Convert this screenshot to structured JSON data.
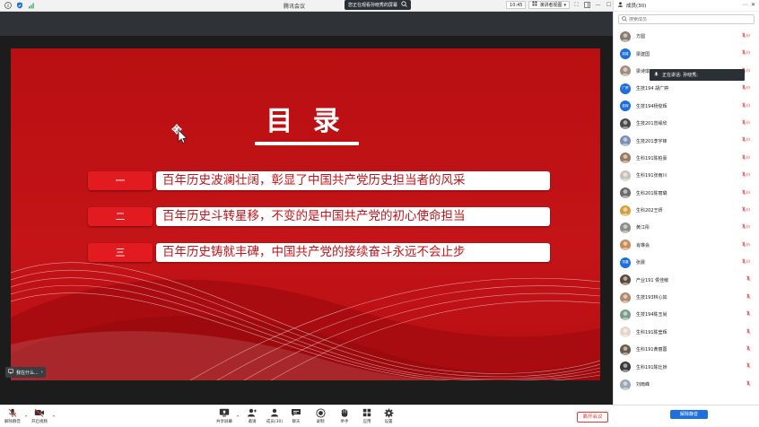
{
  "app": {
    "title": "腾讯会议",
    "share_banner": "您正在观看孙晓秀的屏幕",
    "time": "10:45",
    "view_mode": "演讲者视图"
  },
  "slide": {
    "title": "目 录",
    "items": [
      {
        "num": "一",
        "text": "百年历史波澜壮阔，彰显了中国共产党历史担当者的风采"
      },
      {
        "num": "二",
        "text": "百年历史斗转星移，不变的是中国共产党的初心使命担当"
      },
      {
        "num": "三",
        "text": "百年历史铸就丰碑，中国共产党的接续奋斗永远不会止步"
      }
    ],
    "speaker_label": "我在什么..."
  },
  "toolbar": {
    "mute_label": "解除静音",
    "video_label": "开启视频",
    "share_label": "共享屏幕",
    "invite_label": "邀请",
    "members_label": "成员(30)",
    "chat_label": "聊天",
    "record_label": "录制",
    "hand_label": "举手",
    "apps_label": "应用",
    "settings_label": "设置",
    "leave_label": "离开会议"
  },
  "panel": {
    "title": "成员(30)",
    "search_placeholder": "搜索成员",
    "speaking_tip": "正在讲话: 孙晓秀;",
    "unmute_all": "解除静音",
    "members": [
      {
        "name": "方圆",
        "avatar": "photo",
        "color": "#8a7a6a",
        "mic": "muted"
      },
      {
        "name": "梁建国",
        "avatar": "梁建",
        "color": "#1e6fd9",
        "mic": "muted"
      },
      {
        "name": "梁诗琪",
        "avatar": "photo",
        "color": "#a08d7c",
        "mic": "muted"
      },
      {
        "name": "生技194 胡广婷",
        "avatar": "广婷",
        "color": "#1e6fd9",
        "mic": "muted"
      },
      {
        "name": "生技194杨俊辉",
        "avatar": "俊辉",
        "color": "#1e6fd9",
        "mic": "muted"
      },
      {
        "name": "生技201曾缘欣",
        "avatar": "photo",
        "color": "#4a4a4a",
        "mic": "muted"
      },
      {
        "name": "生技201李宇锋",
        "avatar": "photo",
        "color": "#7a8fb2",
        "mic": "muted"
      },
      {
        "name": "生科191陈柏豪",
        "avatar": "photo",
        "color": "#9a7a62",
        "mic": "muted"
      },
      {
        "name": "生科191张雨川",
        "avatar": "photo",
        "color": "#c9c2b8",
        "mic": "muted"
      },
      {
        "name": "生科201陈丽璐",
        "avatar": "photo",
        "color": "#6a6a6a",
        "mic": "muted"
      },
      {
        "name": "生科202王妍",
        "avatar": "photo",
        "color": "#d4a03c",
        "mic": "muted"
      },
      {
        "name": "黄江彤",
        "avatar": "photo",
        "color": "#8c8c8c",
        "mic": "muted"
      },
      {
        "name": "肖琳会",
        "avatar": "photo",
        "color": "#c78a5a",
        "mic": "muted"
      },
      {
        "name": "张晨",
        "avatar": "张晨",
        "color": "#1e6fd9",
        "mic": "muted"
      },
      {
        "name": "产业191 侯佳敏",
        "avatar": "photo",
        "color": "#5a4a3a",
        "mic": "off"
      },
      {
        "name": "生技193林心如",
        "avatar": "photo",
        "color": "#b08a6a",
        "mic": "off"
      },
      {
        "name": "生技194陈玉尚",
        "avatar": "photo",
        "color": "#7a9a8a",
        "mic": "off"
      },
      {
        "name": "生科191陈莹辉",
        "avatar": "photo",
        "color": "#e2d6ca",
        "mic": "off"
      },
      {
        "name": "生科191黄丽蓉",
        "avatar": "photo",
        "color": "#6a5a4a",
        "mic": "off"
      },
      {
        "name": "生科191陈灶娇",
        "avatar": "photo",
        "color": "#3a3a3a",
        "mic": "off"
      },
      {
        "name": "刘雨峰",
        "avatar": "photo",
        "color": "#9aa6b2",
        "mic": "off"
      }
    ]
  },
  "colors": {
    "slide_red": "#c41418",
    "accent_blue": "#1f6fe0",
    "leave_red": "#e53935",
    "mic_muted": "#e57373"
  }
}
